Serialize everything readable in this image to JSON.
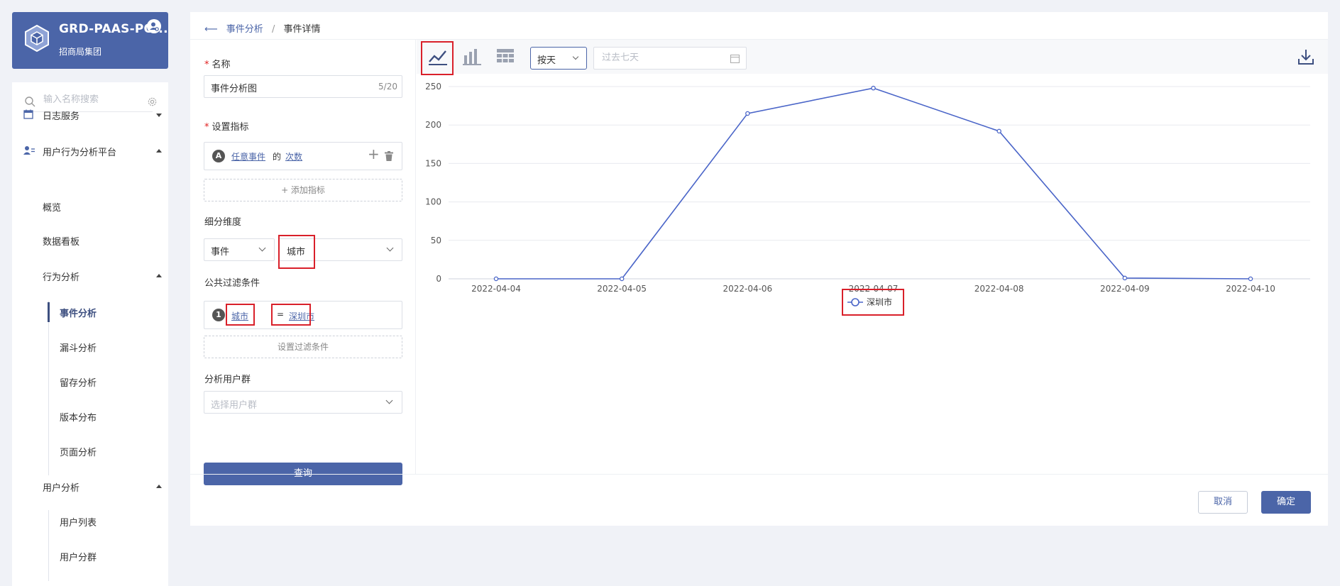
{
  "org": {
    "name": "GRD-PAAS-PO...",
    "subtitle": "招商局集团"
  },
  "sidebar": {
    "search_placeholder": "输入名称搜索",
    "items": [
      {
        "label": "日志服务"
      },
      {
        "label": "用户行为分析平台"
      },
      {
        "label": "概览"
      },
      {
        "label": "数据看板"
      },
      {
        "label": "行为分析"
      },
      {
        "label": "事件分析"
      },
      {
        "label": "漏斗分析"
      },
      {
        "label": "留存分析"
      },
      {
        "label": "版本分布"
      },
      {
        "label": "页面分析"
      },
      {
        "label": "用户分析"
      },
      {
        "label": "用户列表"
      },
      {
        "label": "用户分群"
      }
    ]
  },
  "breadcrumb": {
    "parent": "事件分析",
    "separator": "/",
    "current": "事件详情"
  },
  "form": {
    "name_label": "名称",
    "name_value": "事件分析图",
    "name_counter": "5/20",
    "metric_label": "设置指标",
    "metric_badge": "A",
    "metric_event": "任意事件",
    "metric_of": "的",
    "metric_measure": "次数",
    "add_metric": "+ 添加指标",
    "dimension_label": "细分维度",
    "dimension_type": "事件",
    "dimension_value": "城市",
    "filter_label": "公共过滤条件",
    "filter_index": "1",
    "filter_field": "城市",
    "filter_op": "=",
    "filter_value": "深圳市",
    "set_filter": "设置过滤条件",
    "user_group_label": "分析用户群",
    "user_group_placeholder": "选择用户群",
    "query_button": "查询"
  },
  "toolbar": {
    "granularity": "按天",
    "date_placeholder": "过去七天"
  },
  "chart_data": {
    "type": "line",
    "x": [
      "2022-04-04",
      "2022-04-05",
      "2022-04-06",
      "2022-04-07",
      "2022-04-08",
      "2022-04-09",
      "2022-04-10"
    ],
    "series": [
      {
        "name": "深圳市",
        "values": [
          0,
          0,
          215,
          248,
          192,
          1,
          0
        ],
        "color": "#4a65c8"
      }
    ],
    "ylim": [
      0,
      250
    ],
    "yticks": [
      0,
      50,
      100,
      150,
      200,
      250
    ],
    "grid": true,
    "legend": "bottom-center"
  },
  "footer": {
    "cancel": "取消",
    "ok": "确定"
  }
}
